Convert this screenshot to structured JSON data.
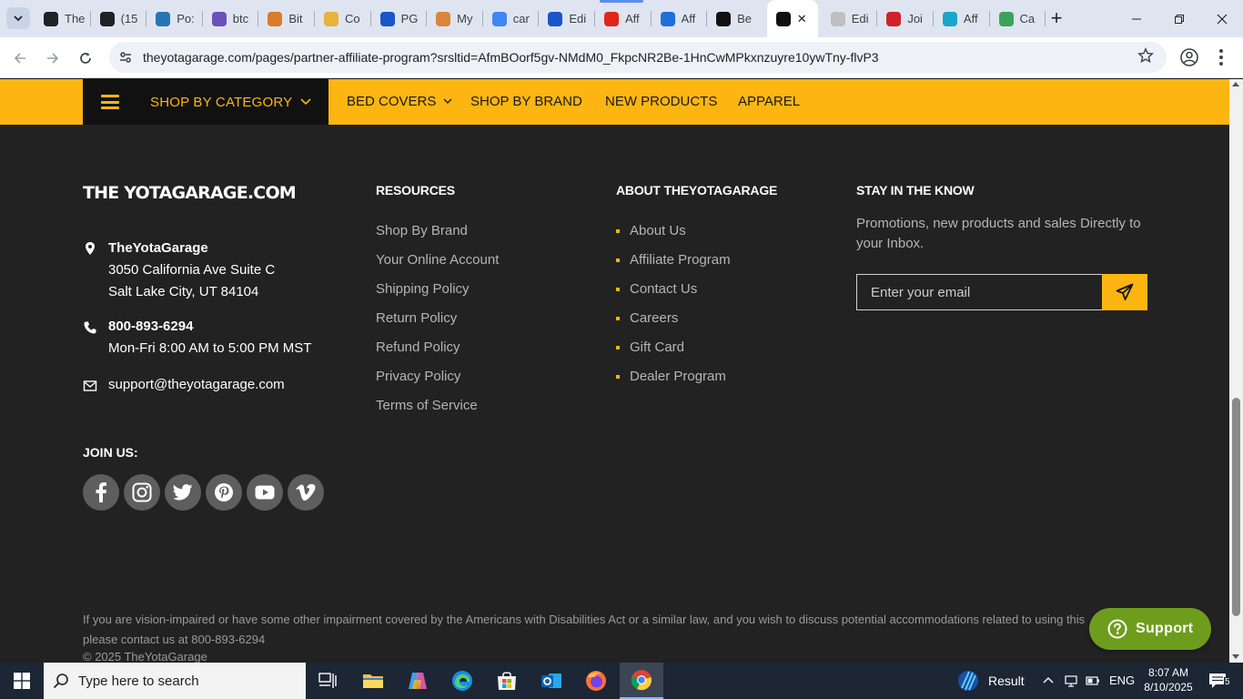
{
  "browser": {
    "tabs": [
      {
        "title": "The",
        "icon": "openai-icon",
        "color": "#202124"
      },
      {
        "title": "(15",
        "icon": "b-icon",
        "color": "#202124"
      },
      {
        "title": "Po:",
        "icon": "xf-icon",
        "color": "#2577b1"
      },
      {
        "title": "btc",
        "icon": "e-icon",
        "color": "#6b4fbb"
      },
      {
        "title": "Bit",
        "icon": "feather-icon",
        "color": "#d97b2a"
      },
      {
        "title": "Co",
        "icon": "c-icon",
        "color": "#e8b33a"
      },
      {
        "title": "PG",
        "icon": "p-icon",
        "color": "#1a56c8"
      },
      {
        "title": "My",
        "icon": "flower-icon",
        "color": "#d9863a"
      },
      {
        "title": "car",
        "icon": "google-icon",
        "color": "#4285f4"
      },
      {
        "title": "Edi",
        "icon": "car-icon",
        "color": "#1a56c8"
      },
      {
        "title": "Aff",
        "icon": "swoosh-icon",
        "color": "#e0271a"
      },
      {
        "title": "Aff",
        "icon": "stripes-icon",
        "color": "#1e6fd9"
      },
      {
        "title": "Be",
        "icon": "star-circle-icon",
        "color": "#111111"
      },
      {
        "title": "",
        "icon": "yota-icon",
        "color": "#111111",
        "active": true
      },
      {
        "title": "Edi",
        "icon": "swirl-icon",
        "color": "#bfbfbf"
      },
      {
        "title": "Joi",
        "icon": "flag-icon",
        "color": "#d0222b"
      },
      {
        "title": "Aff",
        "icon": "c-square-icon",
        "color": "#1aa6c8"
      },
      {
        "title": "Ca",
        "icon": "chart-icon",
        "color": "#3aa35b"
      }
    ],
    "url": "theyotagarage.com/pages/partner-affiliate-program?srsltid=AfmBOorf5gv-NMdM0_FkpcNR2Be-1HnCwMPkxnzuyre10ywTny-flvP3"
  },
  "navbar": {
    "category_label": "SHOP BY CATEGORY",
    "links": [
      "BED COVERS",
      "SHOP BY BRAND",
      "NEW PRODUCTS",
      "APPAREL"
    ]
  },
  "footer": {
    "logo": "THE YOTAGARAGE.COM",
    "company": "TheYotaGarage",
    "address1": "3050 California Ave Suite C",
    "address2": "Salt Lake City, UT 84104",
    "phone": "800-893-6294",
    "hours": "Mon-Fri 8:00 AM to 5:00 PM MST",
    "email": "support@theyotagarage.com",
    "resources_title": "RESOURCES",
    "resources": [
      "Shop By Brand",
      "Your Online Account",
      "Shipping Policy",
      "Return Policy",
      "Refund Policy",
      "Privacy Policy",
      "Terms of Service"
    ],
    "about_title": "ABOUT THEYOTAGARAGE",
    "about": [
      "About Us",
      "Affiliate Program",
      "Contact Us",
      "Careers",
      "Gift Card",
      "Dealer Program"
    ],
    "stay_title": "STAY IN THE KNOW",
    "stay_text": "Promotions, new products and sales Directly to your Inbox.",
    "email_placeholder": "Enter your email",
    "join_label": "JOIN US:",
    "ada_line1": "If you are vision-impaired or have some other impairment covered by the Americans with Disabilities Act or a similar law, and you wish to discuss potential accommodations related to using this",
    "ada_line2": "please contact us at 800-893-6294",
    "copyright": "© 2025 TheYotaGarage",
    "support_label": "Support"
  },
  "taskbar": {
    "search_placeholder": "Type here to search",
    "result_label": "Result",
    "language": "ENG",
    "time": "8:07 AM",
    "date": "8/10/2025",
    "notification_count": "5"
  },
  "colors": {
    "accent": "#fcb511",
    "footer_bg": "#222222",
    "support_green": "#6e9d1d"
  }
}
